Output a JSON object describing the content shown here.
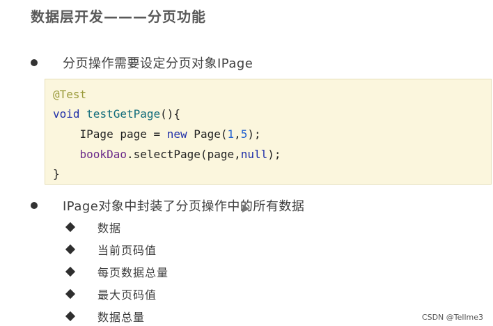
{
  "title": "数据层开发———分页功能",
  "bullets": [
    "分页操作需要设定分页对象IPage",
    "IPage对象中封装了分页操作中的所有数据"
  ],
  "code": {
    "annotation": "@Test",
    "l2_kw": "void",
    "l2_fn": "testGetPage",
    "l2_rest": "(){",
    "l3_a": "    IPage page = ",
    "l3_kw": "new",
    "l3_b": " Page(",
    "l3_n1": "1",
    "l3_c": ",",
    "l3_n2": "5",
    "l3_d": ");",
    "l4_indent": "    ",
    "l4_field": "bookDao",
    "l4_a": ".selectPage(page,",
    "l4_kw": "null",
    "l4_b": ");",
    "l5": "}"
  },
  "sub_items": [
    "数据",
    "当前页码值",
    "每页数据总量",
    "最大页码值",
    "数据总量"
  ],
  "watermark": "CSDN @Tellme3"
}
